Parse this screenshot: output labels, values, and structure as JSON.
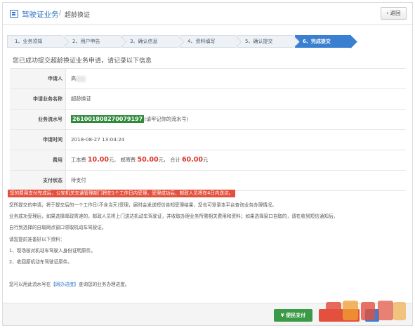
{
  "header": {
    "title": "驾驶证业务",
    "separator": "/",
    "subtitle": "超龄换证",
    "back_label": "‹ 返回"
  },
  "steps": [
    {
      "label": "1、业务须知",
      "active": false
    },
    {
      "label": "2、用户申告",
      "active": false
    },
    {
      "label": "3、确认信息",
      "active": false
    },
    {
      "label": "4、资料填写",
      "active": false
    },
    {
      "label": "5、确认提交",
      "active": false
    },
    {
      "label": "6、完成提交",
      "active": true
    }
  ],
  "notice": "您已成功提交超龄换证业务申请，请记录以下信息",
  "info": {
    "applicant_label": "申请人",
    "applicant_value": "高",
    "business_label": "申请业务名称",
    "business_value": "超龄换证",
    "serial_label": "业务流水号",
    "serial_value": "261001808270079197",
    "serial_note": "(请牢记你的流水号)",
    "time_label": "申请时间",
    "time_value": "2018-08-27 13:04:24",
    "fee_label": "费用",
    "fee_labor_label": "工本费",
    "fee_labor_value": "10.00",
    "fee_post_label": "邮寄费",
    "fee_post_value": "50.00",
    "fee_total_label": "合计",
    "fee_total_value": "60.00",
    "currency": "元",
    "pay_label": "支付状态",
    "pay_value": "待支付"
  },
  "message": {
    "warning": "您的费用支付完成后，公安机关交通管理部门将在1个工作日内受理，受理成功后，邮政人员将在4日内送达。",
    "line1": "您所提交的申请，将于提交后的一个工作日(不含当天)受理，届时会发送短信告知受理结果，您也可登录本平台查询业务办理情况。",
    "line2": "业务成功受理后，如果选择邮政寄递的，邮政人员将上门送达机动车驾驶证，并收取办理业务所需相关费用和资料；如果选择窗口自取的，请在收到短信通知后，",
    "line3": "自行到选择的自取网点窗口领取机动车驾驶证。",
    "line4": "请您提前准备好以下资料：",
    "line5": "1、现场核对机动车驾驶人身份证明原件。",
    "line6": "2、收回原机动车驾驶证原件。",
    "line7_pre": "您可以用此流水号在",
    "line7_link": "【网办进度】",
    "line7_post": "查询您的业务办理进度。"
  },
  "bottom": {
    "pay_button": "¥ 便民支付"
  },
  "colors": {
    "accent": "#3a7fd0",
    "warning": "#e3503d",
    "success": "#3a9a45"
  }
}
